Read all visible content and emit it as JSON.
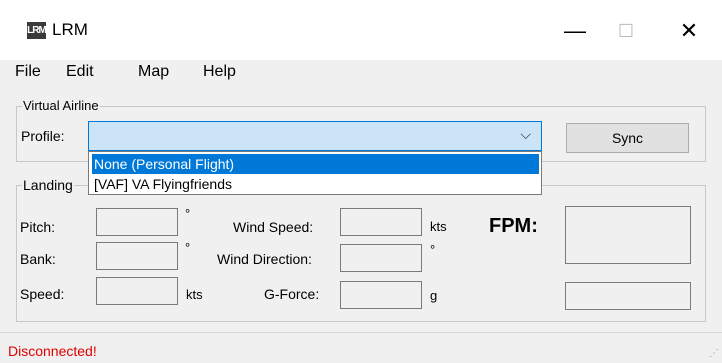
{
  "window": {
    "title": "LRM",
    "logo_text": "LRM",
    "minimize": "—",
    "maximize": "☐",
    "close": "✕"
  },
  "menu": [
    "File",
    "Edit",
    "Map",
    "Help"
  ],
  "virtual_airline": {
    "group_label": "Virtual Airline",
    "profile_label": "Profile:",
    "profile_value": "",
    "profile_options": [
      "None (Personal Flight)",
      "[VAF] VA Flyingfriends"
    ],
    "highlighted_option": "None (Personal Flight)",
    "sync_label": "Sync"
  },
  "landing": {
    "group_label": "Landing",
    "pitch_label": "Pitch:",
    "pitch_unit": "°",
    "bank_label": "Bank:",
    "bank_unit": "°",
    "speed_label": "Speed:",
    "speed_unit": "kts",
    "wind_speed_label": "Wind Speed:",
    "wind_speed_unit": "kts",
    "wind_dir_label": "Wind Direction:",
    "wind_dir_unit": "°",
    "gforce_label": "G-Force:",
    "gforce_unit": "g",
    "fpm_label": "FPM:"
  },
  "status": {
    "text": "Disconnected!"
  }
}
